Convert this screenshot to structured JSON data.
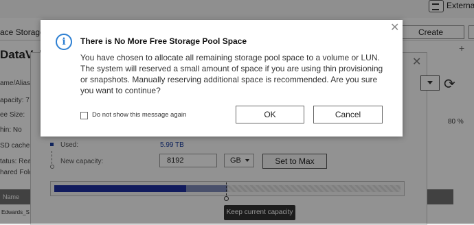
{
  "background": {
    "topbar": {
      "external_label": "Externa"
    },
    "storage_title": "ace Storage",
    "create_button": "Create",
    "volume_title": "DataVol",
    "add_symbol": "+",
    "left_labels": [
      "ame/Alias:",
      "apacity:  7",
      "ee Size:",
      "hin:    No",
      "SD cache:",
      "tatus:  Rea",
      "hared Folde"
    ],
    "percent_label": "80 %",
    "used_label": "Used:",
    "used_value": "5.99 TB",
    "new_capacity_label": "New capacity:",
    "capacity_input_value": "8192",
    "unit_selected": "GB",
    "set_to_max_button": "Set to Max",
    "capacity_bar": {
      "used_fraction": 0.38,
      "reserved_fraction": 0.12
    },
    "tooltip": "Keep current capacity",
    "table_header": "Name",
    "table_row_name": "Edwards_S",
    "colors": {
      "used": "#1e2fa0",
      "reserved": "#7f8ab8",
      "info": "#2d7fd2"
    }
  },
  "modal": {
    "title": "There is No More Free Storage Pool Space",
    "message": "You have chosen to allocate all remaining storage pool space to a volume or LUN. The system will reserved a small amount of space if you are using thin provisioning or snapshots. Manually reserving additional space is recommended. Are you sure you want to continue?",
    "checkbox_label": "Do not show this message again",
    "checkbox_checked": false,
    "ok_button": "OK",
    "cancel_button": "Cancel",
    "info_icon": "info-icon",
    "close_icon": "close-icon"
  }
}
